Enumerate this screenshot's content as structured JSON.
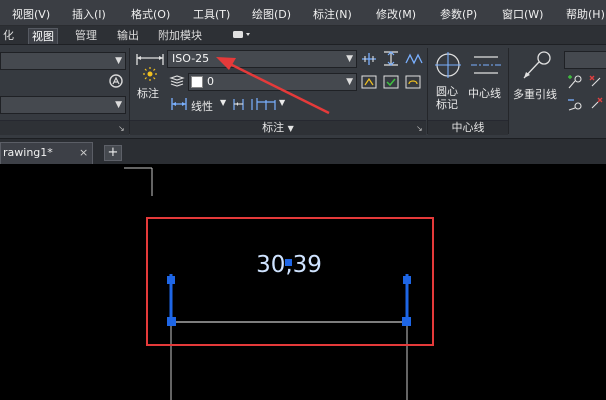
{
  "menubar": {
    "items": [
      "视图(V)",
      "插入(I)",
      "格式(O)",
      "工具(T)",
      "绘图(D)",
      "标注(N)",
      "修改(M)",
      "参数(P)",
      "窗口(W)",
      "帮助(H)"
    ]
  },
  "ribbon_tabs": {
    "items": [
      "化",
      "视图",
      "管理",
      "输出",
      "附加模块"
    ],
    "active": "视图"
  },
  "dimension_panel": {
    "dim_button_label": "标注",
    "style_dropdown_value": "ISO-25",
    "layer_dropdown_value": "0",
    "linear_label": "线性",
    "panel_title": "标注"
  },
  "centerline_panel": {
    "center_mark_label": "圆心\n标记",
    "center_mark_line1": "圆心",
    "center_mark_line2": "标记",
    "centerline_label": "中心线",
    "panel_title": "中心线"
  },
  "leader_panel": {
    "multileader_label": "多重引线"
  },
  "document_tab": {
    "title": "rawing1*",
    "close_glyph": "×",
    "new_tab_glyph": "+"
  },
  "drawing": {
    "dimension_text": "30,39",
    "highlight_color": "#e53a3a",
    "grip_color": "#1e66e6",
    "text_color": "#cfe3ff",
    "line_color": "#c8c8c8"
  },
  "annotation": {
    "arrow_color": "#e53a3a"
  }
}
